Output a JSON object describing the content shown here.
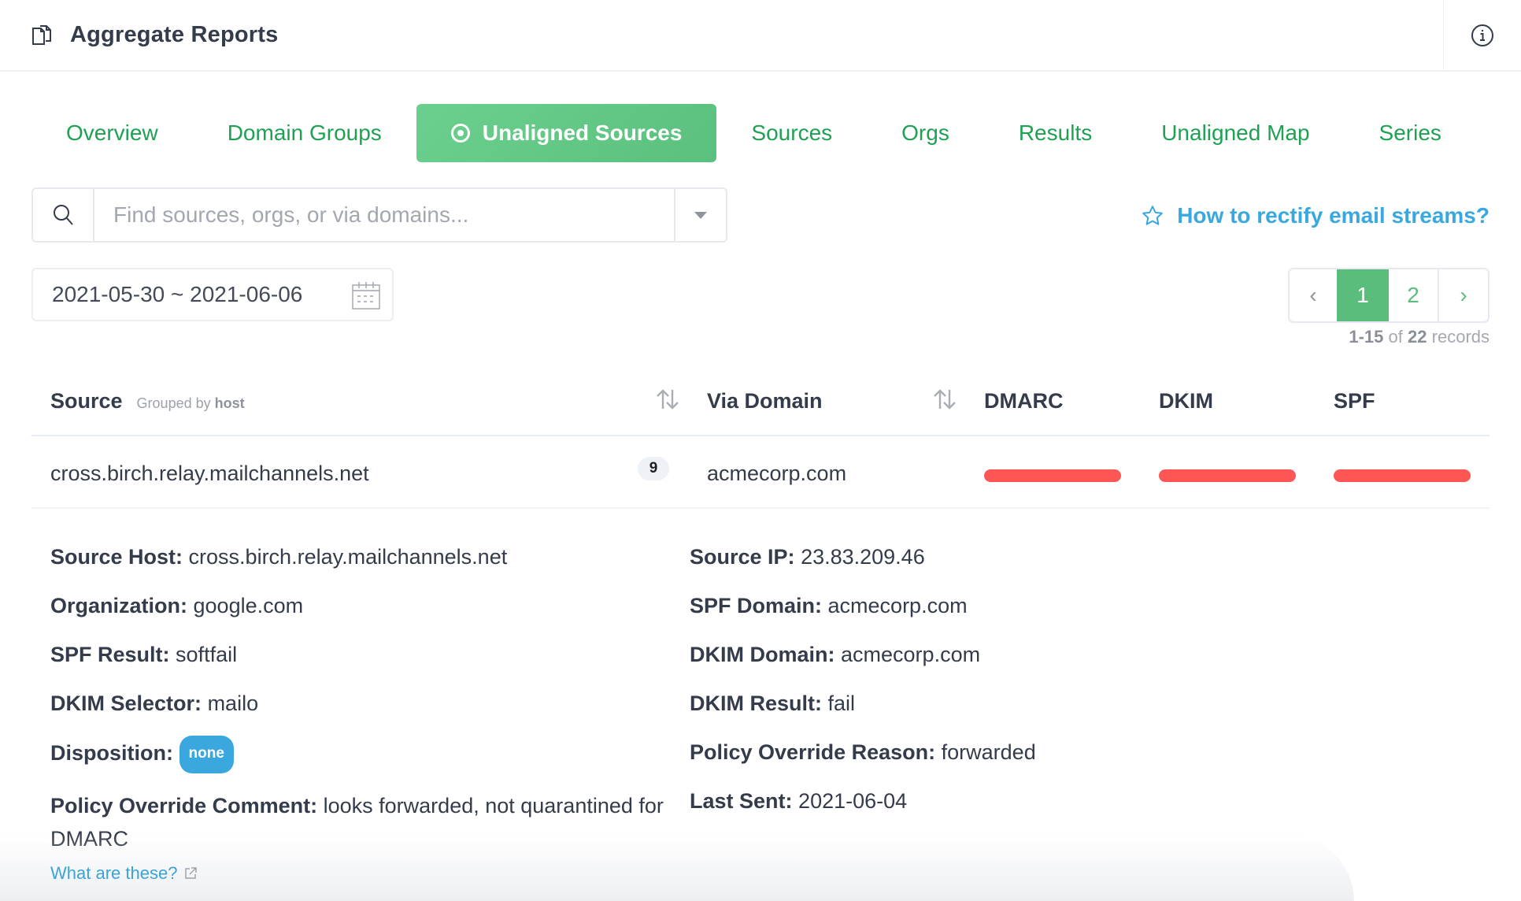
{
  "header": {
    "title": "Aggregate Reports",
    "icons": {
      "left": "documents-icon",
      "right": "info-icon"
    }
  },
  "tabs": [
    {
      "label": "Overview",
      "active": false
    },
    {
      "label": "Domain Groups",
      "active": false
    },
    {
      "label": "Unaligned Sources",
      "active": true,
      "icon": "radio-target-icon"
    },
    {
      "label": "Sources",
      "active": false
    },
    {
      "label": "Orgs",
      "active": false
    },
    {
      "label": "Results",
      "active": false
    },
    {
      "label": "Unaligned Map",
      "active": false
    },
    {
      "label": "Series",
      "active": false
    }
  ],
  "search": {
    "placeholder": "Find sources, orgs, or via domains...",
    "value": ""
  },
  "help_link": {
    "label": "How to rectify email streams?",
    "icon": "star-icon"
  },
  "date_range": {
    "value": "2021-05-30 ~ 2021-06-06",
    "icon": "calendar-icon"
  },
  "pagination": {
    "prev": "‹",
    "pages": [
      "1",
      "2"
    ],
    "current": "1",
    "next": "›",
    "range_start_end": "1-15",
    "of_label": "of",
    "total": "22",
    "records_label": "records"
  },
  "table": {
    "columns": {
      "source": "Source",
      "grouped_by_prefix": "Grouped by",
      "grouped_by_value": "host",
      "via_domain": "Via Domain",
      "dmarc": "DMARC",
      "dkim": "DKIM",
      "spf": "SPF"
    },
    "rows": [
      {
        "source": "cross.birch.relay.mailchannels.net",
        "count": "9",
        "via_domain": "acmecorp.com",
        "dmarc_status": "fail",
        "dkim_status": "fail",
        "spf_status": "fail",
        "status_color": "#fe5555"
      }
    ]
  },
  "details": {
    "left": [
      {
        "label": "Source Host:",
        "value": "cross.birch.relay.mailchannels.net"
      },
      {
        "label": "Organization:",
        "value": "google.com"
      },
      {
        "label": "SPF Result:",
        "value": "softfail"
      },
      {
        "label": "DKIM Selector:",
        "value": "mailo"
      },
      {
        "label": "Disposition:",
        "value": "none",
        "badge": true
      },
      {
        "label": "Policy Override Comment:",
        "value": "looks forwarded, not quarantined for DMARC"
      }
    ],
    "right": [
      {
        "label": "Source IP:",
        "value": "23.83.209.46"
      },
      {
        "label": "SPF Domain:",
        "value": "acmecorp.com"
      },
      {
        "label": "DKIM Domain:",
        "value": "acmecorp.com"
      },
      {
        "label": "DKIM Result:",
        "value": "fail"
      },
      {
        "label": "Policy Override Reason:",
        "value": "forwarded"
      },
      {
        "label": "Last Sent:",
        "value": "2021-06-04"
      }
    ],
    "what_link": "What are these?"
  },
  "colors": {
    "accent_green": "#1fa154",
    "active_tab_green": "#5bbf7d",
    "link_blue": "#39a8e0",
    "fail_red": "#fe5555",
    "badge_blue": "#3ba7df"
  }
}
